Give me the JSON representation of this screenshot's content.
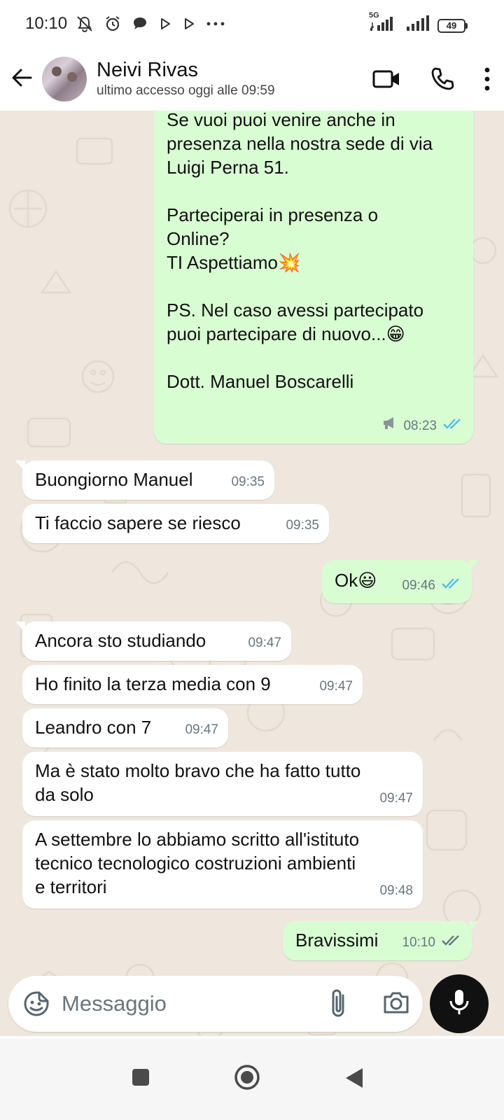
{
  "status_bar": {
    "time": "10:10",
    "network_label": "5G",
    "battery_level": "49",
    "icons": [
      "mute-alarm-icon",
      "alarm-icon",
      "chat-bubble-icon",
      "play-icon",
      "play-icon",
      "more-dots-icon",
      "signal-icon",
      "signal-icon",
      "battery-icon"
    ]
  },
  "header": {
    "contact_name": "Neivi Rivas",
    "last_seen": "ultimo accesso oggi alle 09:59",
    "icons": [
      "back-arrow-icon",
      "video-call-icon",
      "phone-icon",
      "more-vert-icon"
    ]
  },
  "colors": {
    "outgoing_bubble": "#d9fdd3",
    "incoming_bubble": "#ffffff",
    "chat_background": "#efe7dd",
    "read_ticks": "#53bdeb",
    "delivered_ticks": "#667781"
  },
  "messages": [
    {
      "direction": "out",
      "text": "Se vuoi puoi venire anche in\npresenza nella nostra sede di via\nLuigi Perna 51.\n\nParteciperai in presenza o\nOnline?\nTI Aspettiamo💥\n\nPS. Nel caso avessi partecipato\npuoi partecipare di nuovo...😁\n\nDott. Manuel Boscarelli",
      "time": "08:23",
      "status": "read",
      "broadcast": true
    },
    {
      "direction": "in",
      "text": "Buongiorno Manuel",
      "time": "09:35"
    },
    {
      "direction": "in",
      "text": "Ti faccio sapere se riesco",
      "time": "09:35"
    },
    {
      "direction": "out",
      "text": "Ok😃",
      "time": "09:46",
      "status": "read"
    },
    {
      "direction": "in",
      "text": "Ancora sto studiando",
      "time": "09:47"
    },
    {
      "direction": "in",
      "text": "Ho finito la terza media con 9",
      "time": "09:47"
    },
    {
      "direction": "in",
      "text": "Leandro con 7",
      "time": "09:47"
    },
    {
      "direction": "in",
      "text": "Ma è stato molto bravo che ha fatto tutto\nda solo",
      "time": "09:47"
    },
    {
      "direction": "in",
      "text": "A settembre lo abbiamo scritto all'istituto\ntecnico tecnologico costruzioni ambienti\ne territori",
      "time": "09:48"
    },
    {
      "direction": "out",
      "text": "Bravissimi",
      "time": "10:10",
      "status": "delivered"
    }
  ],
  "composer": {
    "placeholder": "Messaggio",
    "icons": [
      "emoji-sticker-icon",
      "paperclip-icon",
      "camera-icon",
      "microphone-icon"
    ]
  },
  "nav_bar": {
    "icons": [
      "recents-square-icon",
      "home-circle-icon",
      "back-triangle-icon"
    ]
  }
}
